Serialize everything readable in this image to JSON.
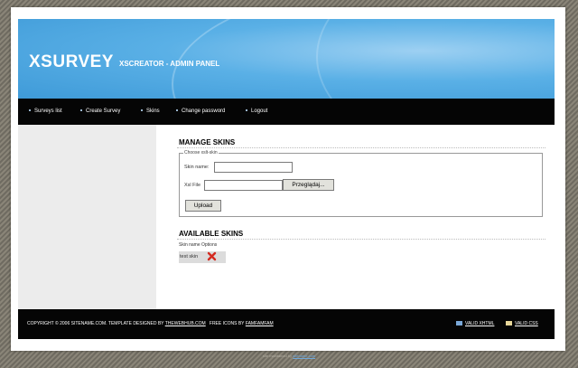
{
  "header": {
    "logo": "XSURVEY",
    "subtitle": "XSCREATOR - ADMIN PANEL"
  },
  "nav": {
    "items": [
      {
        "label": "Surveys list"
      },
      {
        "label": "Create Survey"
      },
      {
        "label": "Skins"
      },
      {
        "label": "Change password"
      },
      {
        "label": "Logout"
      }
    ]
  },
  "manage": {
    "title": "MANAGE SKINS",
    "legend": "Choose xslt-skin",
    "skin_name_label": "Skin name:",
    "skin_name_value": "",
    "xsl_file_label": "Xsl File",
    "xsl_file_value": "",
    "browse_label": "Przeglądaj...",
    "upload_label": "Upload"
  },
  "available": {
    "title": "AVAILABLE SKINS",
    "header": "Skin name Options",
    "skins": [
      {
        "name": "test skin",
        "delete_icon": "delete-x-icon"
      }
    ]
  },
  "footer": {
    "copyright": "COPYRIGHT © 2006 SITENAME.COM. TEMPLATE DESIGNED BY",
    "designer": "THEWEBHUB.COM",
    "icons_by": "FREE ICONS BY",
    "icons_author": "FAMFAMFAM",
    "valid_xhtml": "VALID XHTML",
    "valid_css": "VALID CSS"
  },
  "credit": {
    "text": "site maintained by",
    "link": "sitename.com"
  },
  "colors": {
    "header_blue": "#3e9ad8",
    "bar_black": "#050505",
    "delete_red": "#d42a20"
  }
}
